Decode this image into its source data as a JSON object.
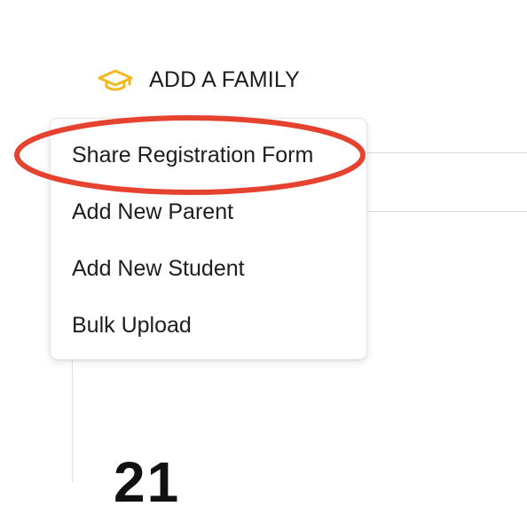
{
  "trigger": {
    "label": "ADD A FAMILY",
    "icon": "graduation-cap-icon",
    "icon_color": "#F2B91E"
  },
  "menu": {
    "items": [
      {
        "label": "Share Registration Form"
      },
      {
        "label": "Add New Parent"
      },
      {
        "label": "Add New Student"
      },
      {
        "label": "Bulk Upload"
      }
    ]
  },
  "background": {
    "partial_number": "21"
  },
  "annotation": {
    "shape": "ellipse",
    "color": "#E5432F",
    "target": "Share Registration Form"
  }
}
